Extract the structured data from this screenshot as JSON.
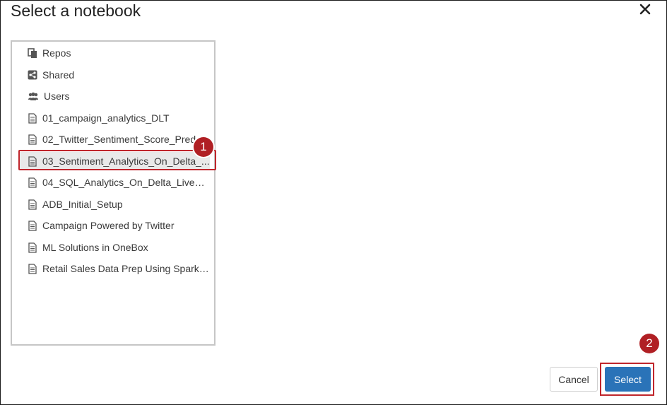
{
  "dialog": {
    "title": "Select a notebook"
  },
  "tree": {
    "items": [
      {
        "label": "Repos",
        "icon": "repo-icon"
      },
      {
        "label": "Shared",
        "icon": "share-icon"
      },
      {
        "label": "Users",
        "icon": "users-icon"
      },
      {
        "label": "01_campaign_analytics_DLT",
        "icon": "notebook-icon"
      },
      {
        "label": "02_Twitter_Sentiment_Score_Pred_...",
        "icon": "notebook-icon"
      },
      {
        "label": "03_Sentiment_Analytics_On_Delta_...",
        "icon": "notebook-icon",
        "selected": true
      },
      {
        "label": "04_SQL_Analytics_On_Delta_Live_T...",
        "icon": "notebook-icon"
      },
      {
        "label": "ADB_Initial_Setup",
        "icon": "notebook-icon"
      },
      {
        "label": "Campaign Powered by Twitter",
        "icon": "notebook-icon"
      },
      {
        "label": "ML Solutions in OneBox",
        "icon": "notebook-icon"
      },
      {
        "label": "Retail Sales Data Prep Using Spark ...",
        "icon": "notebook-icon"
      }
    ]
  },
  "annotations": {
    "step1": "1",
    "step2": "2"
  },
  "footer": {
    "cancel_label": "Cancel",
    "select_label": "Select"
  },
  "colors": {
    "primary": "#2a73b8",
    "highlight": "#c0262c",
    "badge": "#b01f24"
  }
}
